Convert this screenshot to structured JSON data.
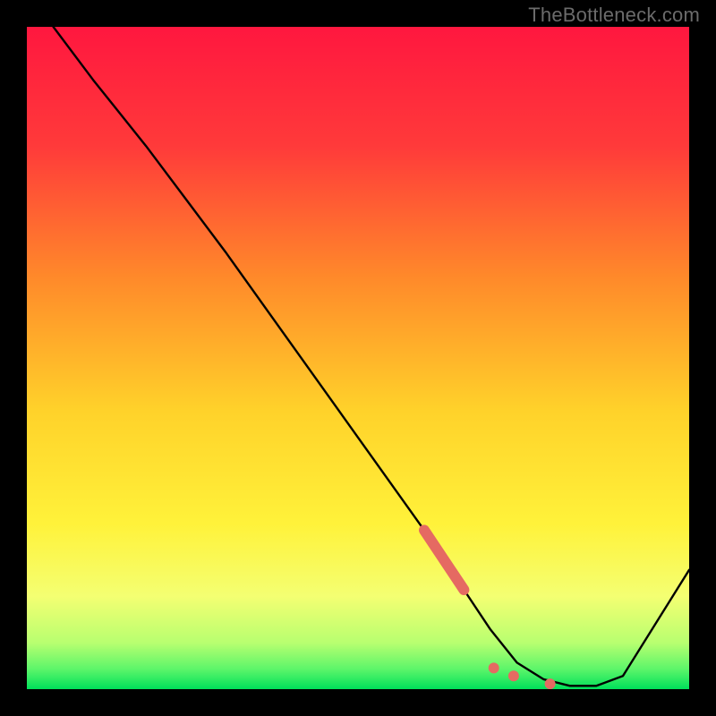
{
  "watermark": "TheBottleneck.com",
  "colors": {
    "frame": "#000000",
    "watermark_text": "#6b6b6b",
    "gradient_top": "#ff173f",
    "gradient_mid1": "#ff7a2a",
    "gradient_mid2": "#ffe02a",
    "gradient_mid3": "#f8ff6a",
    "gradient_bottom": "#00e05a",
    "line": "#000000",
    "marker": "#e56a62"
  },
  "chart_data": {
    "type": "line",
    "title": "",
    "xlabel": "",
    "ylabel": "",
    "xlim": [
      0,
      100
    ],
    "ylim": [
      0,
      100
    ],
    "series": [
      {
        "name": "curve",
        "x": [
          4,
          10,
          18,
          24,
          30,
          40,
          50,
          60,
          66,
          70,
          74,
          78,
          82,
          86,
          90,
          100
        ],
        "y": [
          100,
          92,
          82,
          74,
          66,
          52,
          38,
          24,
          15,
          9,
          4,
          1.5,
          0.5,
          0.5,
          2,
          18
        ]
      }
    ],
    "highlight_segment": {
      "x0": 60,
      "y0": 24,
      "x1": 66,
      "y1": 15
    },
    "markers": [
      {
        "x": 70.5,
        "y": 3.2
      },
      {
        "x": 73.5,
        "y": 2.0
      },
      {
        "x": 79.0,
        "y": 0.8
      }
    ]
  }
}
